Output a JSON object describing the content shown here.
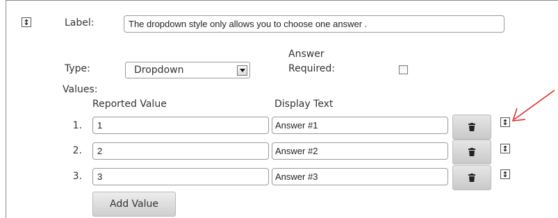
{
  "header": {
    "label_caption": "Label:",
    "label_value": "The dropdown style only allows you to choose one answer ."
  },
  "type": {
    "caption": "Type:",
    "selected": "Dropdown"
  },
  "answer_required": {
    "caption_line1": "Answer",
    "caption_line2": "Required:",
    "checked": false
  },
  "values": {
    "caption": "Values:",
    "col_reported": "Reported Value",
    "col_display": "Display Text",
    "rows": [
      {
        "num": "1.",
        "reported": "1",
        "display": "Answer #1"
      },
      {
        "num": "2.",
        "reported": "2",
        "display": "Answer #2"
      },
      {
        "num": "3.",
        "reported": "3",
        "display": "Answer #3"
      }
    ],
    "add_label": "Add Value"
  },
  "icons": {
    "drag": "updown-arrow-icon",
    "delete": "trash-icon",
    "annotation": "red-arrow-icon"
  },
  "colors": {
    "annotation_arrow": "#e02020"
  }
}
